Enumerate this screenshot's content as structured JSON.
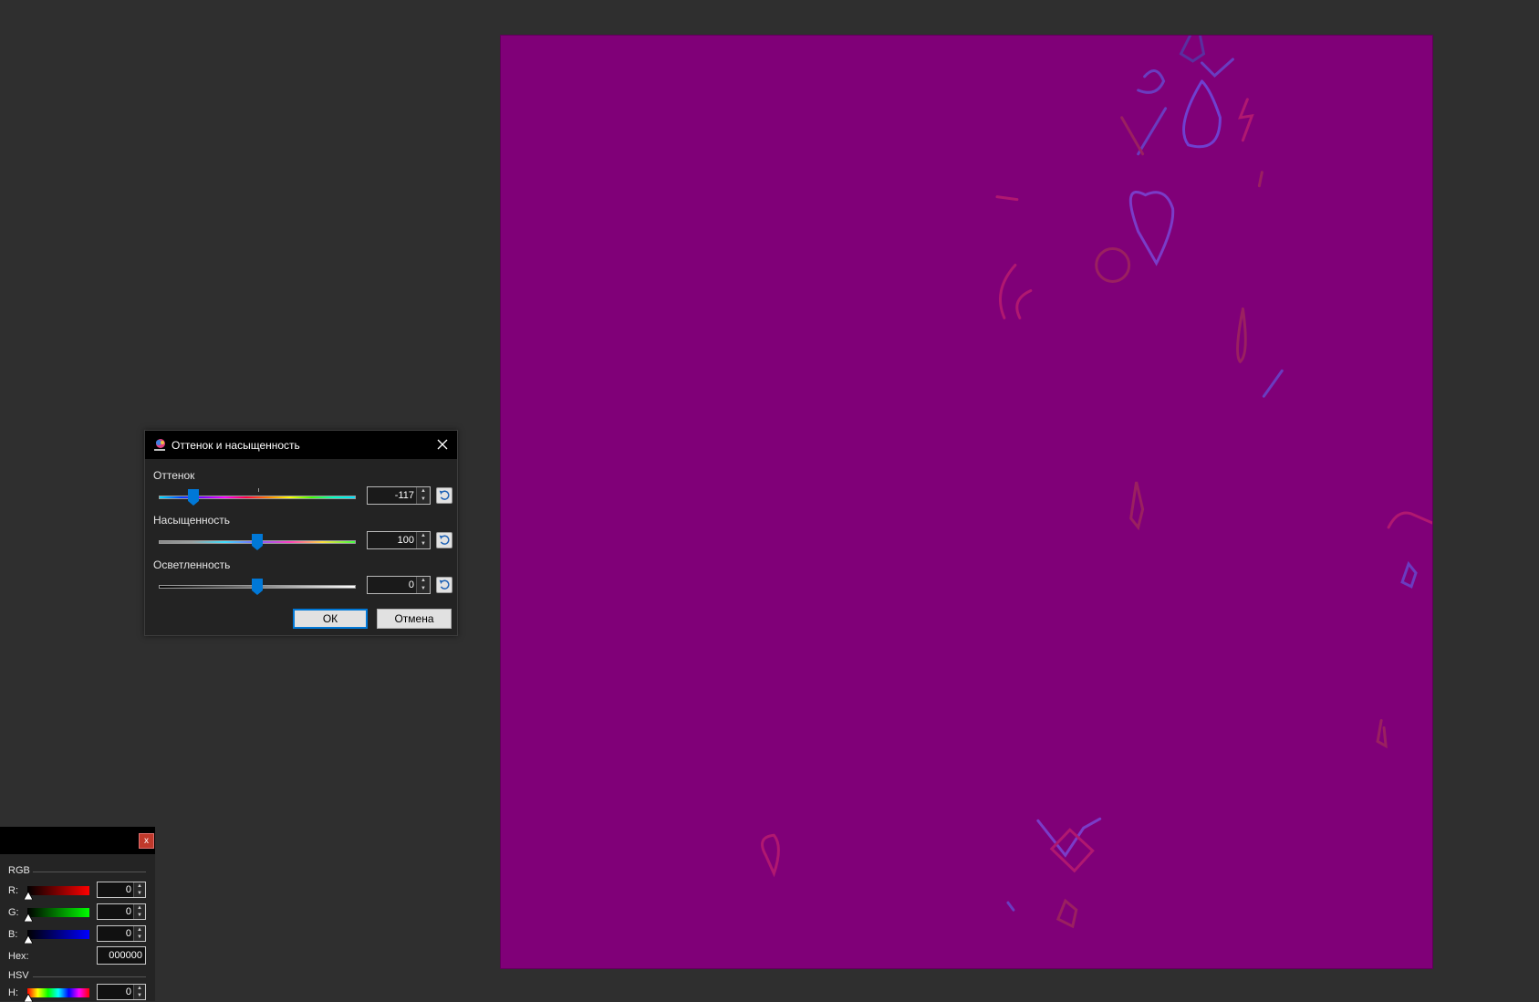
{
  "dialog": {
    "title": "Оттенок и насыщенность",
    "hue": {
      "label": "Оттенок",
      "value": "-117",
      "min": -180,
      "max": 180,
      "level": -117
    },
    "saturation": {
      "label": "Насыщенность",
      "value": "100",
      "min": 0,
      "max": 200,
      "level": 100
    },
    "lightness": {
      "label": "Осветленность",
      "value": "0",
      "min": -100,
      "max": 100,
      "level": 0
    },
    "ok_label": "ОК",
    "cancel_label": "Отмена"
  },
  "colors": {
    "canvas_fill": "#800078",
    "accent": "#0078d7",
    "close_red": "#c0392b"
  },
  "color_panel": {
    "rgb_section": "RGB",
    "r_label": "R:",
    "r_value": "0",
    "g_label": "G:",
    "g_value": "0",
    "b_label": "B:",
    "b_value": "0",
    "hex_label": "Hex:",
    "hex_value": "000000",
    "hsv_section": "HSV",
    "h_label": "H:",
    "h_value": "0",
    "close_label": "x"
  },
  "icons": [
    "app-palette-icon",
    "close-icon",
    "reset-icon",
    "spin-up-icon",
    "spin-down-icon"
  ]
}
